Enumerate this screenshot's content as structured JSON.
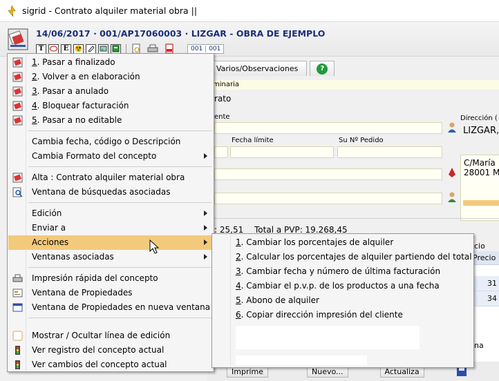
{
  "window": {
    "title": "sigrid - Contrato alquiler material obra ||"
  },
  "header": {
    "doc_title": "14/06/2017 · 001/AP17060003 · LIZGAR - OBRA DE EJEMPLO",
    "toolbar": [
      "T",
      "",
      "E",
      "",
      "",
      "",
      ""
    ],
    "counter": [
      "001",
      "001"
    ]
  },
  "tabs": [
    {
      "label": "Varios/Observaciones"
    },
    {
      "label": "?"
    }
  ],
  "form": {
    "partial_label_1": "minaria",
    "partial_value_1": "rato",
    "partial_label_2": "ente",
    "fecha_limite_label": "Fecha límite",
    "pedido_label": "Su Nº Pedido",
    "direccion_label": "Dirección (",
    "client_name": "LIZGAR,",
    "address_line1": "C/María",
    "address_line2": "28001 M",
    "totals_left": ": 25,51",
    "totals_pvp": "Total a PVP: 19.268,45",
    "precio_hdr_partial": "cio para",
    "precio_hdr": "Precio",
    "precio_values": [
      "31",
      "34"
    ],
    "partial_na": "na"
  },
  "bottom_bar": {
    "imprime": "Imprime",
    "nuevo": "Nuevo...",
    "actualiza": "Actualiza"
  },
  "menu": {
    "items": [
      {
        "num": "1",
        "text": ". Pasar a finalizado",
        "icon": "status-red-icon"
      },
      {
        "num": "2",
        "text": ". Volver a en elaboración",
        "icon": "status-red-icon"
      },
      {
        "num": "3",
        "text": ". Pasar a anulado",
        "icon": "status-red-icon"
      },
      {
        "num": "4",
        "text": ". Bloquear facturación",
        "icon": "status-red-icon"
      },
      {
        "num": "5",
        "text": ". Pasar a no editable",
        "icon": "status-red-icon"
      },
      {
        "text": "Cambia fecha, código o Descripción"
      },
      {
        "text": "Cambia Formato del concepto",
        "submenu": true
      },
      {
        "text": "Alta : Contrato alquiler material obra",
        "icon": "new-doc-icon"
      },
      {
        "text": "Ventana de búsquedas asociadas",
        "icon": "search-icon"
      },
      {
        "text": "Edición",
        "submenu": true
      },
      {
        "text": "Enviar a",
        "submenu": true
      },
      {
        "text": "Acciones",
        "submenu": true
      },
      {
        "text": "Ventanas asociadas",
        "submenu": true
      },
      {
        "text": "Impresión rápida del concepto",
        "icon": "printer-icon"
      },
      {
        "text": "Ventana de Propiedades",
        "icon": "properties-icon"
      },
      {
        "text": "Ventana de Propiedades en nueva ventana",
        "icon": "window-icon"
      },
      {
        "text": "Mostrar / Ocultar línea de edición",
        "icon": "toggle-icon"
      },
      {
        "text": "Ver registro del concepto actual",
        "icon": "traffic-light-icon"
      },
      {
        "text": "Ver cambios del concepto actual",
        "icon": "traffic-light-icon"
      }
    ]
  },
  "submenu": {
    "items": [
      {
        "num": "1",
        "text": ". Cambiar los porcentajes de alquiler"
      },
      {
        "num": "2",
        "text": ". Calcular los porcentajes de alquiler partiendo del total"
      },
      {
        "num": "3",
        "text": ". Cambiar fecha y número de última facturación"
      },
      {
        "num": "4",
        "text": ". Cambiar el p.v.p. de los productos a una fecha"
      },
      {
        "num": "5",
        "text": ". Abono de alquiler"
      },
      {
        "num": "6",
        "text": ". Copiar dirección impresión del cliente"
      }
    ]
  },
  "colors": {
    "accent_title": "#1b2f7a",
    "menu_highlight": "#f3ca7b",
    "field_bg": "#fffff4"
  }
}
